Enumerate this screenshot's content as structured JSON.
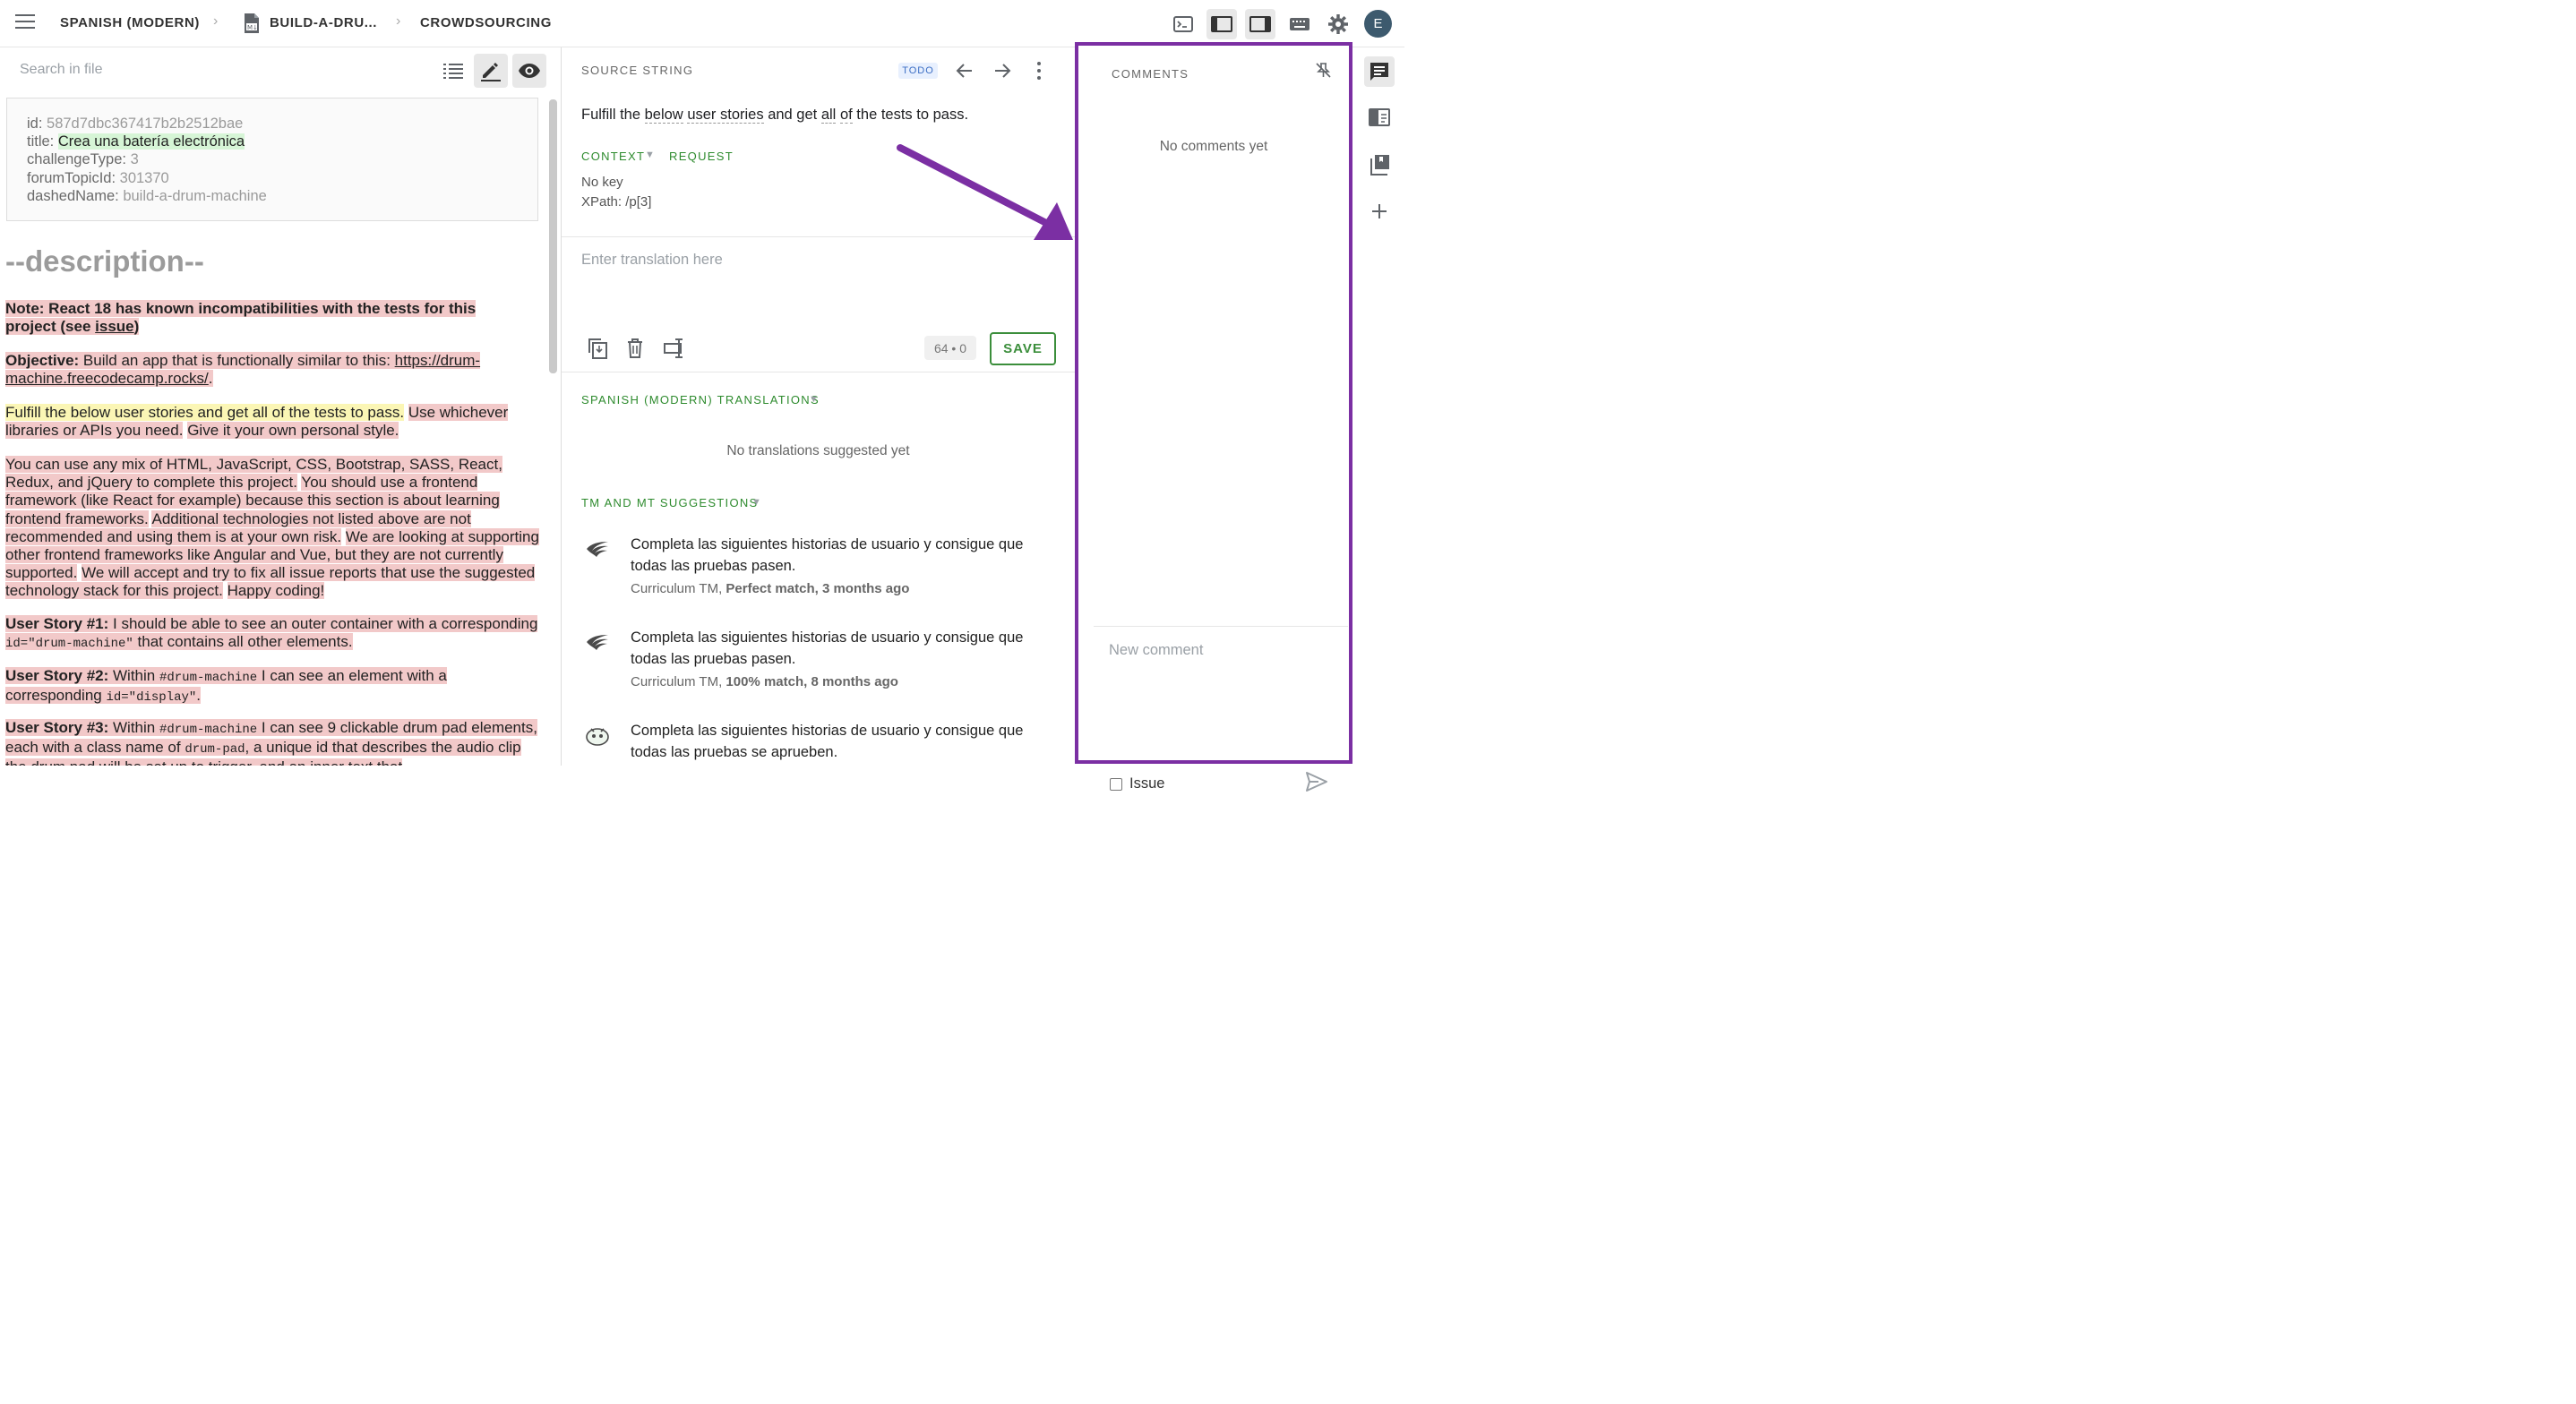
{
  "header": {
    "project": "SPANISH (MODERN)",
    "file": "BUILD-A-DRU...",
    "section": "CROWDSOURCING",
    "user_initial": "E"
  },
  "left": {
    "search_placeholder": "Search in file",
    "meta": [
      {
        "key": "id:",
        "value": "587d7dbc367417b2b2512bae"
      },
      {
        "key": "title:",
        "value": "Crea una batería electrónica"
      },
      {
        "key": "challengeType:",
        "value": "3"
      },
      {
        "key": "forumTopicId:",
        "value": "301370"
      },
      {
        "key": "dashedName:",
        "value": "build-a-drum-machine"
      }
    ],
    "description_heading": "--description--",
    "note_a": "Note: React 18 has known incompatibilities with the tests for this",
    "note_b": "project (see ",
    "note_link": "issue",
    "note_c": ")",
    "obj_label": "Objective:",
    "obj_text": " Build an app that is functionally similar to this: ",
    "obj_link": "https://drum-machine.freecodecamp.rocks/",
    "obj_end": ".",
    "fulfill": "Fulfill the below user stories and get all of the tests to pass.",
    "whichever": "Use whichever libraries or APIs you need.",
    "style": "Give it your own personal style.",
    "mix_1": "You can use any mix of HTML, JavaScript, CSS, Bootstrap, SASS, React, Redux, and jQuery to complete this project.",
    "mix_2": "You should use a frontend framework (like React for example) because this section is about learning frontend frameworks.",
    "mix_3": "Additional technologies not listed above are not recommended and using them is at your own risk.",
    "mix_4": "We are looking at supporting other frontend frameworks like Angular and Vue, but they are not currently supported.",
    "mix_5": "We will accept and try to fix all issue reports that use the suggested technology stack for this project.",
    "mix_6": "Happy coding!",
    "us1_label": "User Story #1:",
    "us1_a": " I should be able to see an outer container with a corresponding ",
    "us1_code": "id=\"drum-machine\"",
    "us1_b": " that contains all other elements.",
    "us2_label": "User Story #2:",
    "us2_a": " Within ",
    "us2_code1": "#drum-machine",
    "us2_b": " I can see an element with a corresponding ",
    "us2_code2": "id=\"display\"",
    "us2_c": ".",
    "us3_label": "User Story #3:",
    "us3_a": " Within ",
    "us3_code1": "#drum-machine",
    "us3_b": " I can see 9 clickable drum pad elements, each with a class name of ",
    "us3_code2": "drum-pad",
    "us3_c": ", a unique id that describes the audio clip the drum pad will be set up to trigger, and an inner text that"
  },
  "middle": {
    "source_label": "SOURCE STRING",
    "todo_badge": "TODO",
    "source_words": [
      "Fulfill the ",
      "below",
      " ",
      "user stories",
      " and get ",
      "all",
      " ",
      "of",
      " the tests to pass."
    ],
    "context_tab": "CONTEXT",
    "request_tab": "REQUEST",
    "no_key": "No key",
    "xpath": "XPath: /p[3]",
    "translation_placeholder": "Enter translation here",
    "char_count": "64 • 0",
    "save_label": "SAVE",
    "translations_label": "SPANISH (MODERN) TRANSLATIONS",
    "no_translations": "No translations suggested yet",
    "tm_label": "TM AND MT SUGGESTIONS",
    "suggestions": [
      {
        "text": "Completa las siguientes historias de usuario y consigue que todas las pruebas pasen.",
        "source": "Curriculum TM, ",
        "match": "Perfect match, 3 months ago"
      },
      {
        "text": "Completa las siguientes historias de usuario y consigue que todas las pruebas pasen.",
        "source": "Curriculum TM, ",
        "match": "100% match, 8 months ago"
      },
      {
        "text": "Completa las siguientes historias de usuario y consigue que todas las pruebas se aprueben.",
        "source": "",
        "match": ""
      }
    ]
  },
  "comments": {
    "title": "COMMENTS",
    "no_comments": "No comments yet",
    "new_comment_placeholder": "New comment",
    "issue_label": "Issue"
  },
  "colors": {
    "accent_green": "#3b8e3b",
    "highlight_purple": "#7b2fa3"
  }
}
